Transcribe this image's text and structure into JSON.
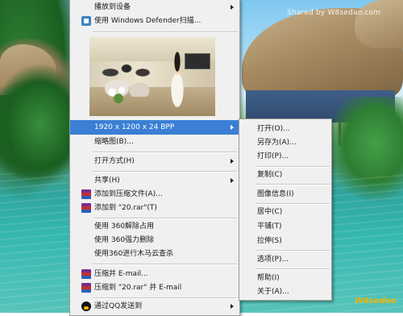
{
  "watermark_top": "Shared by W8sedao.com",
  "watermark_bottom": "W8sedao",
  "main_menu": {
    "cast_to_device": "播放到设备",
    "scan_defender": "使用 Windows Defender扫描...",
    "resolution": "1920 x 1200 x 24 BPP",
    "thumbnail": "缩略图(B)...",
    "open_with": "打开方式(H)",
    "share": "共享(H)",
    "add_to_archive": "添加到压缩文件(A)...",
    "add_to_rar": "添加到 \"20.rar\"(T)",
    "unlock_360": "使用 360解除占用",
    "force_delete_360": "使用 360强力删除",
    "scan_trojan_360": "使用360进行木马云查杀",
    "compress_email": "压缩并 E-mail...",
    "compress_rar_email": "压缩到 \"20.rar\" 并 E-mail",
    "send_qq": "通过QQ发送到"
  },
  "sub_menu": {
    "open": "打开(O)...",
    "save_as": "另存为(A)...",
    "print": "打印(P)...",
    "copy": "复制(C)",
    "image_info": "图像信息(I)",
    "center": "居中(C)",
    "tile": "平铺(T)",
    "stretch": "拉伸(S)",
    "options": "选项(P)...",
    "help": "帮助(I)",
    "about": "关于(A)..."
  },
  "colors": {
    "highlight": "#3a7fd5",
    "menu_bg": "#f0f0f0"
  }
}
